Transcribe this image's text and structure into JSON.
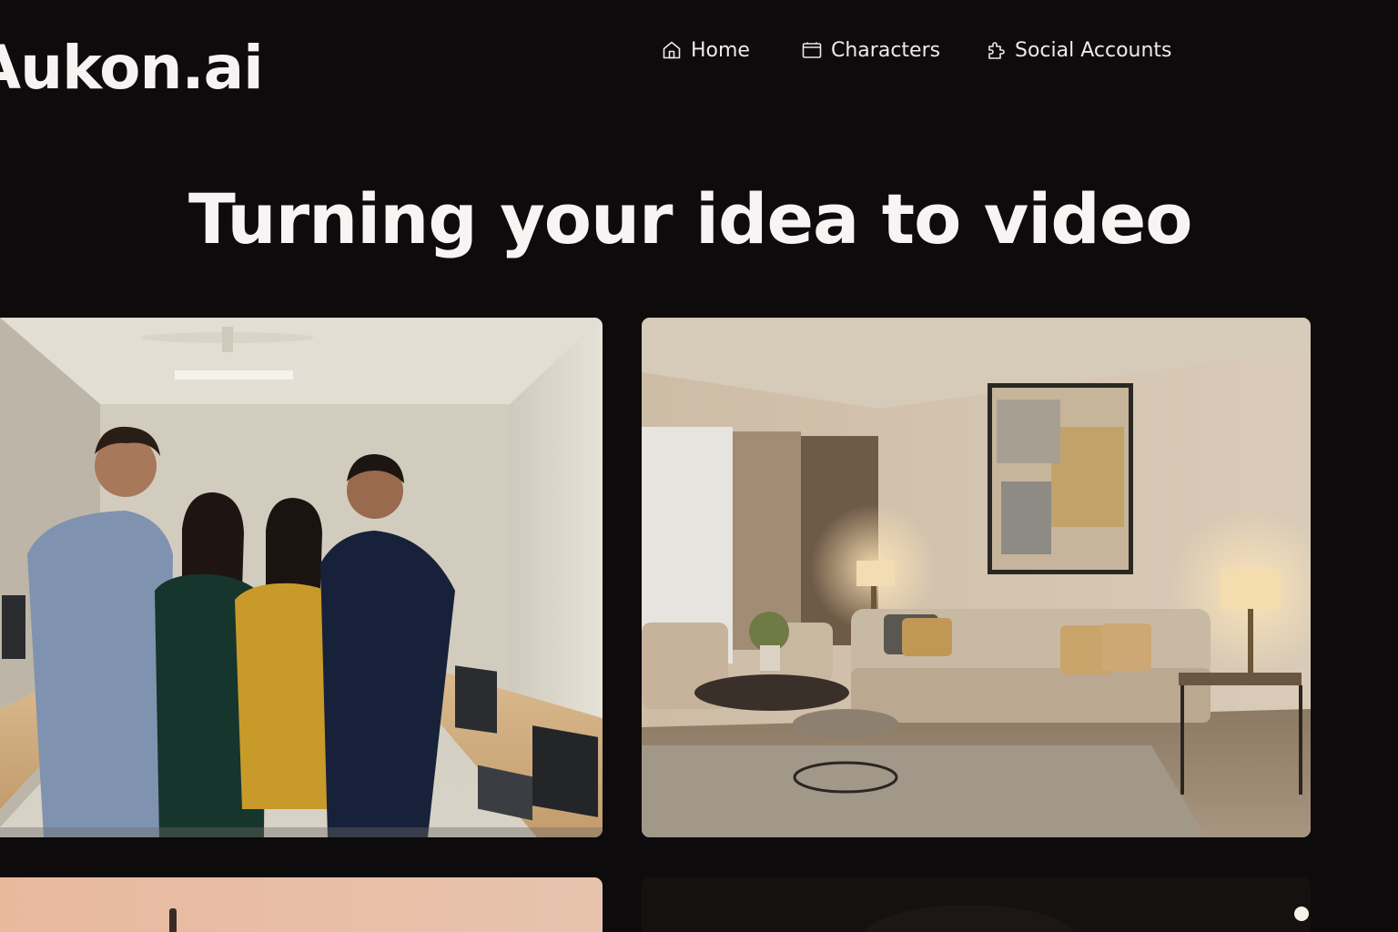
{
  "brand": {
    "logo_text": "Aukon.ai"
  },
  "nav": {
    "items": [
      {
        "label": "Home",
        "icon": "home-icon"
      },
      {
        "label": "Characters",
        "icon": "folder-icon"
      },
      {
        "label": "Social Accounts",
        "icon": "puzzle-icon"
      }
    ]
  },
  "hero": {
    "title": "Turning your idea to video"
  },
  "gallery": {
    "items": [
      {
        "name": "team-office-photo"
      },
      {
        "name": "living-room-photo"
      },
      {
        "name": "sunset-scene-photo"
      },
      {
        "name": "night-scene-photo"
      }
    ]
  },
  "colors": {
    "background": "#0d0b0c",
    "text": "#f4f2f0"
  }
}
